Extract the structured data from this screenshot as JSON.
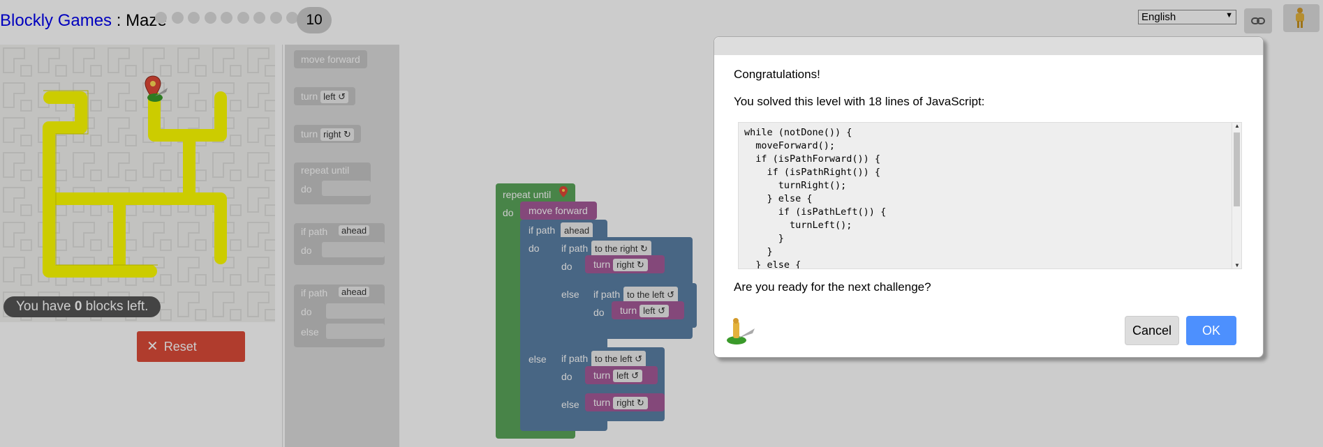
{
  "header": {
    "app_name": "Blockly Games",
    "separator": " : ",
    "game_name": "Maze",
    "current_level": "10",
    "language": "English"
  },
  "maze": {
    "blocks_left_prefix": "You have ",
    "blocks_left_count": "0",
    "blocks_left_suffix": " blocks left.",
    "reset_label": "Reset",
    "path_color": "#ffff00"
  },
  "toolbox": {
    "move_forward": "move forward",
    "turn": "turn",
    "left": "left ↺",
    "right": "right ↻",
    "repeat_until": "repeat until",
    "do": "do",
    "if_path": "if path",
    "ahead": "ahead",
    "else": "else"
  },
  "program": {
    "repeat_until": "repeat until",
    "do": "do",
    "move_forward": "move forward",
    "if_path": "if path",
    "ahead": "ahead",
    "to_the_right": "to the right ↻",
    "to_the_left": "to the left ↺",
    "turn": "turn",
    "right": "right ↻",
    "left": "left ↺",
    "else": "else"
  },
  "dialog": {
    "congrats": "Congratulations!",
    "solved": "You solved this level with 18 lines of JavaScript:",
    "code": "while (notDone()) {\n  moveForward();\n  if (isPathForward()) {\n    if (isPathRight()) {\n      turnRight();\n    } else {\n      if (isPathLeft()) {\n        turnLeft();\n      }\n    }\n  } else {",
    "question": "Are you ready for the next challenge?",
    "cancel": "Cancel",
    "ok": "OK"
  },
  "colors": {
    "reset_button": "#dd4b39",
    "ok_button": "#4d90fe",
    "loop_block": "#5ba55b",
    "action_block": "#a55b99",
    "logic_block": "#5b80a5"
  },
  "icons": [
    "link-icon",
    "pegman-icon",
    "marker-icon",
    "close-icon",
    "rotate-icon"
  ]
}
